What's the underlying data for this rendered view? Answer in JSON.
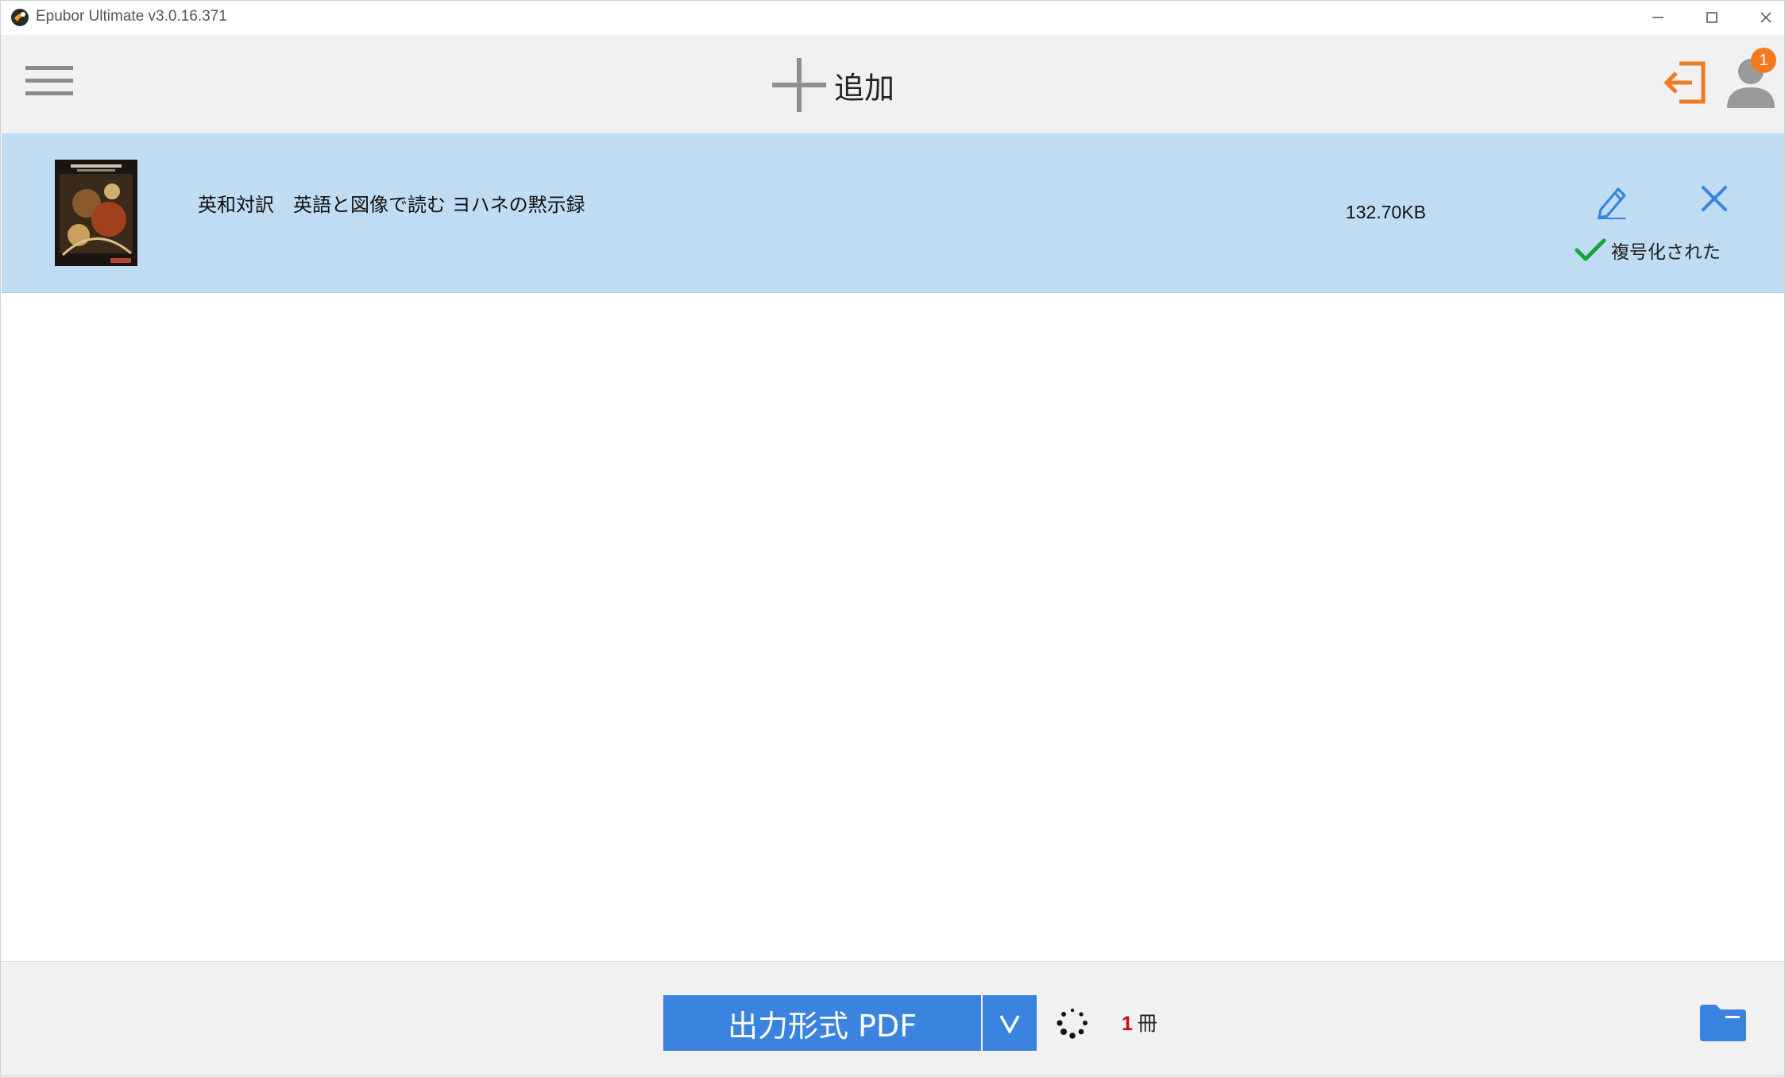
{
  "window": {
    "title": "Epubor Ultimate v3.0.16.371"
  },
  "toolbar": {
    "add_label": "追加",
    "notification_count": "1"
  },
  "books": [
    {
      "title": "英和対訳　英語と図像で読む ヨハネの黙示録",
      "size": "132.70KB",
      "status": "複号化された"
    }
  ],
  "bottom": {
    "convert_label": "出力形式 PDF",
    "count_num": "1",
    "count_unit": "冊"
  },
  "colors": {
    "accent": "#3a84e0",
    "row_selected": "#bfdcf3",
    "orange": "#f47a20",
    "success": "#1aa33a",
    "count_red": "#d0021b"
  }
}
